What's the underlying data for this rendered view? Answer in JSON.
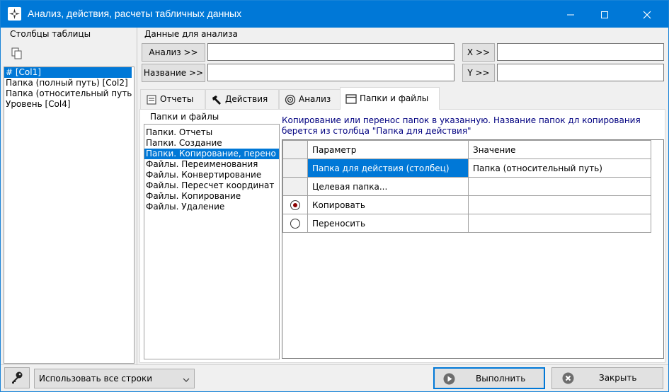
{
  "window": {
    "title": "Анализ, действия, расчеты табличных данных"
  },
  "columns_panel": {
    "label": "Столбцы таблицы",
    "items": [
      "# [Col1]",
      "Папка (полный путь) [Col2]",
      "Папка (относительный путь",
      "Уровень [Col4]"
    ]
  },
  "analysis_data": {
    "label": "Данные для анализа",
    "analysis_button": "Анализ >>",
    "name_button": "Название >>",
    "x_button": "X >>",
    "y_button": "Y >>",
    "analysis_value": "",
    "name_value": "",
    "x_value": "",
    "y_value": ""
  },
  "tabs": [
    {
      "label": "Отчеты",
      "icon": "report-icon"
    },
    {
      "label": "Действия",
      "icon": "hammer-icon"
    },
    {
      "label": "Анализ",
      "icon": "target-icon"
    },
    {
      "label": "Папки и файлы",
      "icon": "folder-icon",
      "active": true
    }
  ],
  "folders_files": {
    "label": "Папки и файлы",
    "items": [
      "Папки. Отчеты",
      "Папки. Создание",
      "Папки. Копирование, перено",
      "Файлы. Переименования",
      "Файлы. Конвертирование",
      "Файлы. Пересчет координат",
      "Файлы. Копирование",
      "Файлы. Удаление"
    ],
    "selected_index": 2
  },
  "description": {
    "line1": "Копирование или перенос папок в указанную. Название папок дл копирования",
    "line2": "берется из столбца \"Папка для действия\""
  },
  "grid": {
    "headers": [
      "Параметр",
      "Значение"
    ],
    "rows": [
      {
        "param": "Папка для действия (столбец)",
        "value": "Папка (относительный путь)",
        "selected": true
      },
      {
        "param": "Целевая папка...",
        "value": ""
      },
      {
        "param": "Копировать",
        "value": "",
        "radio": "on"
      },
      {
        "param": "Переносить",
        "value": "",
        "radio": "off"
      }
    ]
  },
  "footer": {
    "rows_select": "Использовать все строки",
    "run_button": "Выполнить",
    "close_button": "Закрыть"
  }
}
